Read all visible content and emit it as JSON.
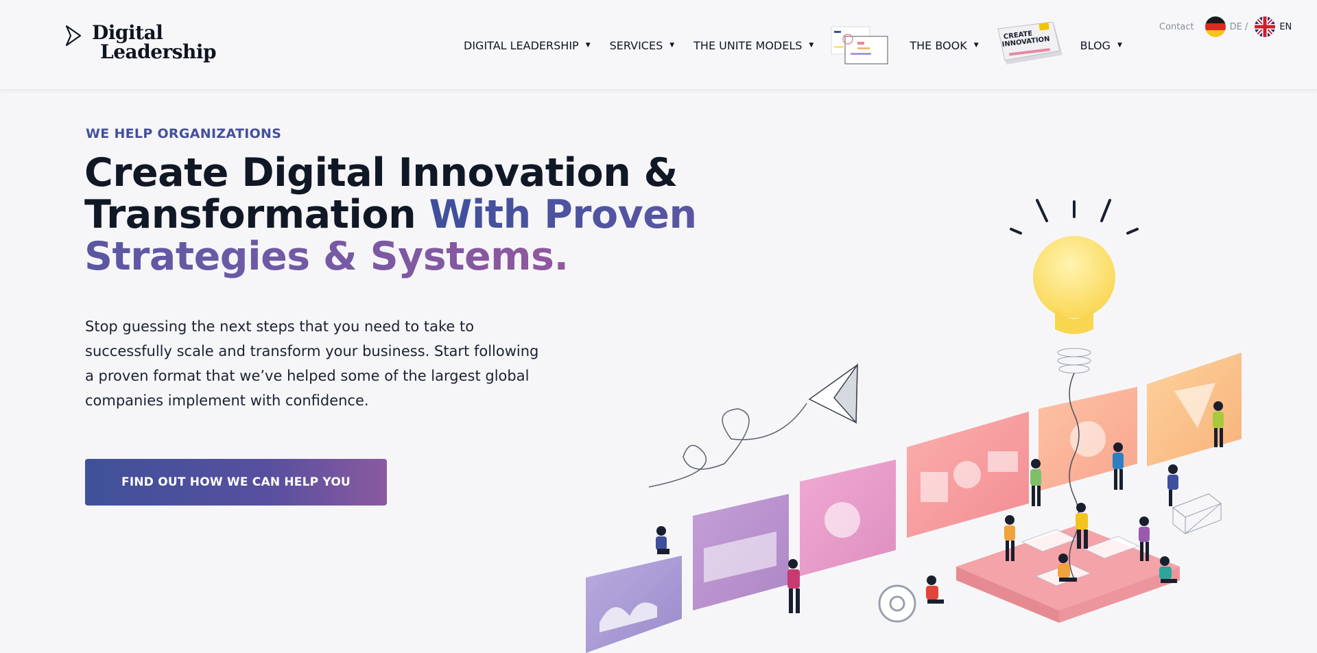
{
  "brand": {
    "line1": "Digital",
    "line2": "Leadership"
  },
  "nav": {
    "items": [
      {
        "label": "DIGITAL LEADERSHIP"
      },
      {
        "label": "SERVICES"
      },
      {
        "label": "THE UNITE MODELS"
      },
      {
        "label": "THE BOOK"
      },
      {
        "label": "BLOG"
      }
    ],
    "caret": "▼"
  },
  "book_cover_text": {
    "line1": "CREATE",
    "line2": "INNOVATION"
  },
  "lang": {
    "contact": "Contact",
    "de": "DE /",
    "en": "EN"
  },
  "hero": {
    "eyebrow": "WE HELP ORGANIZATIONS",
    "headline_part1": "Create Digital Innovation & Transformation ",
    "headline_part2": "With Proven Strategies & Systems.",
    "body": "Stop guessing the next steps that you need to take to successfully scale and transform your business. Start following a proven format that we’ve helped some of the largest global companies implement with confidence.",
    "cta": "FIND OUT HOW WE CAN HELP YOU"
  },
  "colors": {
    "accent_blue": "#44509b",
    "accent_purple": "#8a5a9f",
    "panel_purple": "#a79ad3",
    "panel_pink": "#e39bc8",
    "panel_salmon": "#f59a9a",
    "panel_orange": "#f7b97c",
    "bulb_yellow": "#fce27a"
  }
}
